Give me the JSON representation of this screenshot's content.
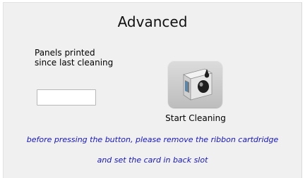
{
  "header": {
    "title": "Advanced"
  },
  "counter": {
    "label_line1": "Panels printed",
    "label_line2": "since last cleaning",
    "value": ""
  },
  "cleaning": {
    "button_icon": "printer-cleaning-icon",
    "button_label": "Start Cleaning"
  },
  "instructions": {
    "line1": "before pressing the button, please remove the ribbon cartdridge",
    "line2": "and set the card in back slot",
    "color": "#1515c8"
  }
}
